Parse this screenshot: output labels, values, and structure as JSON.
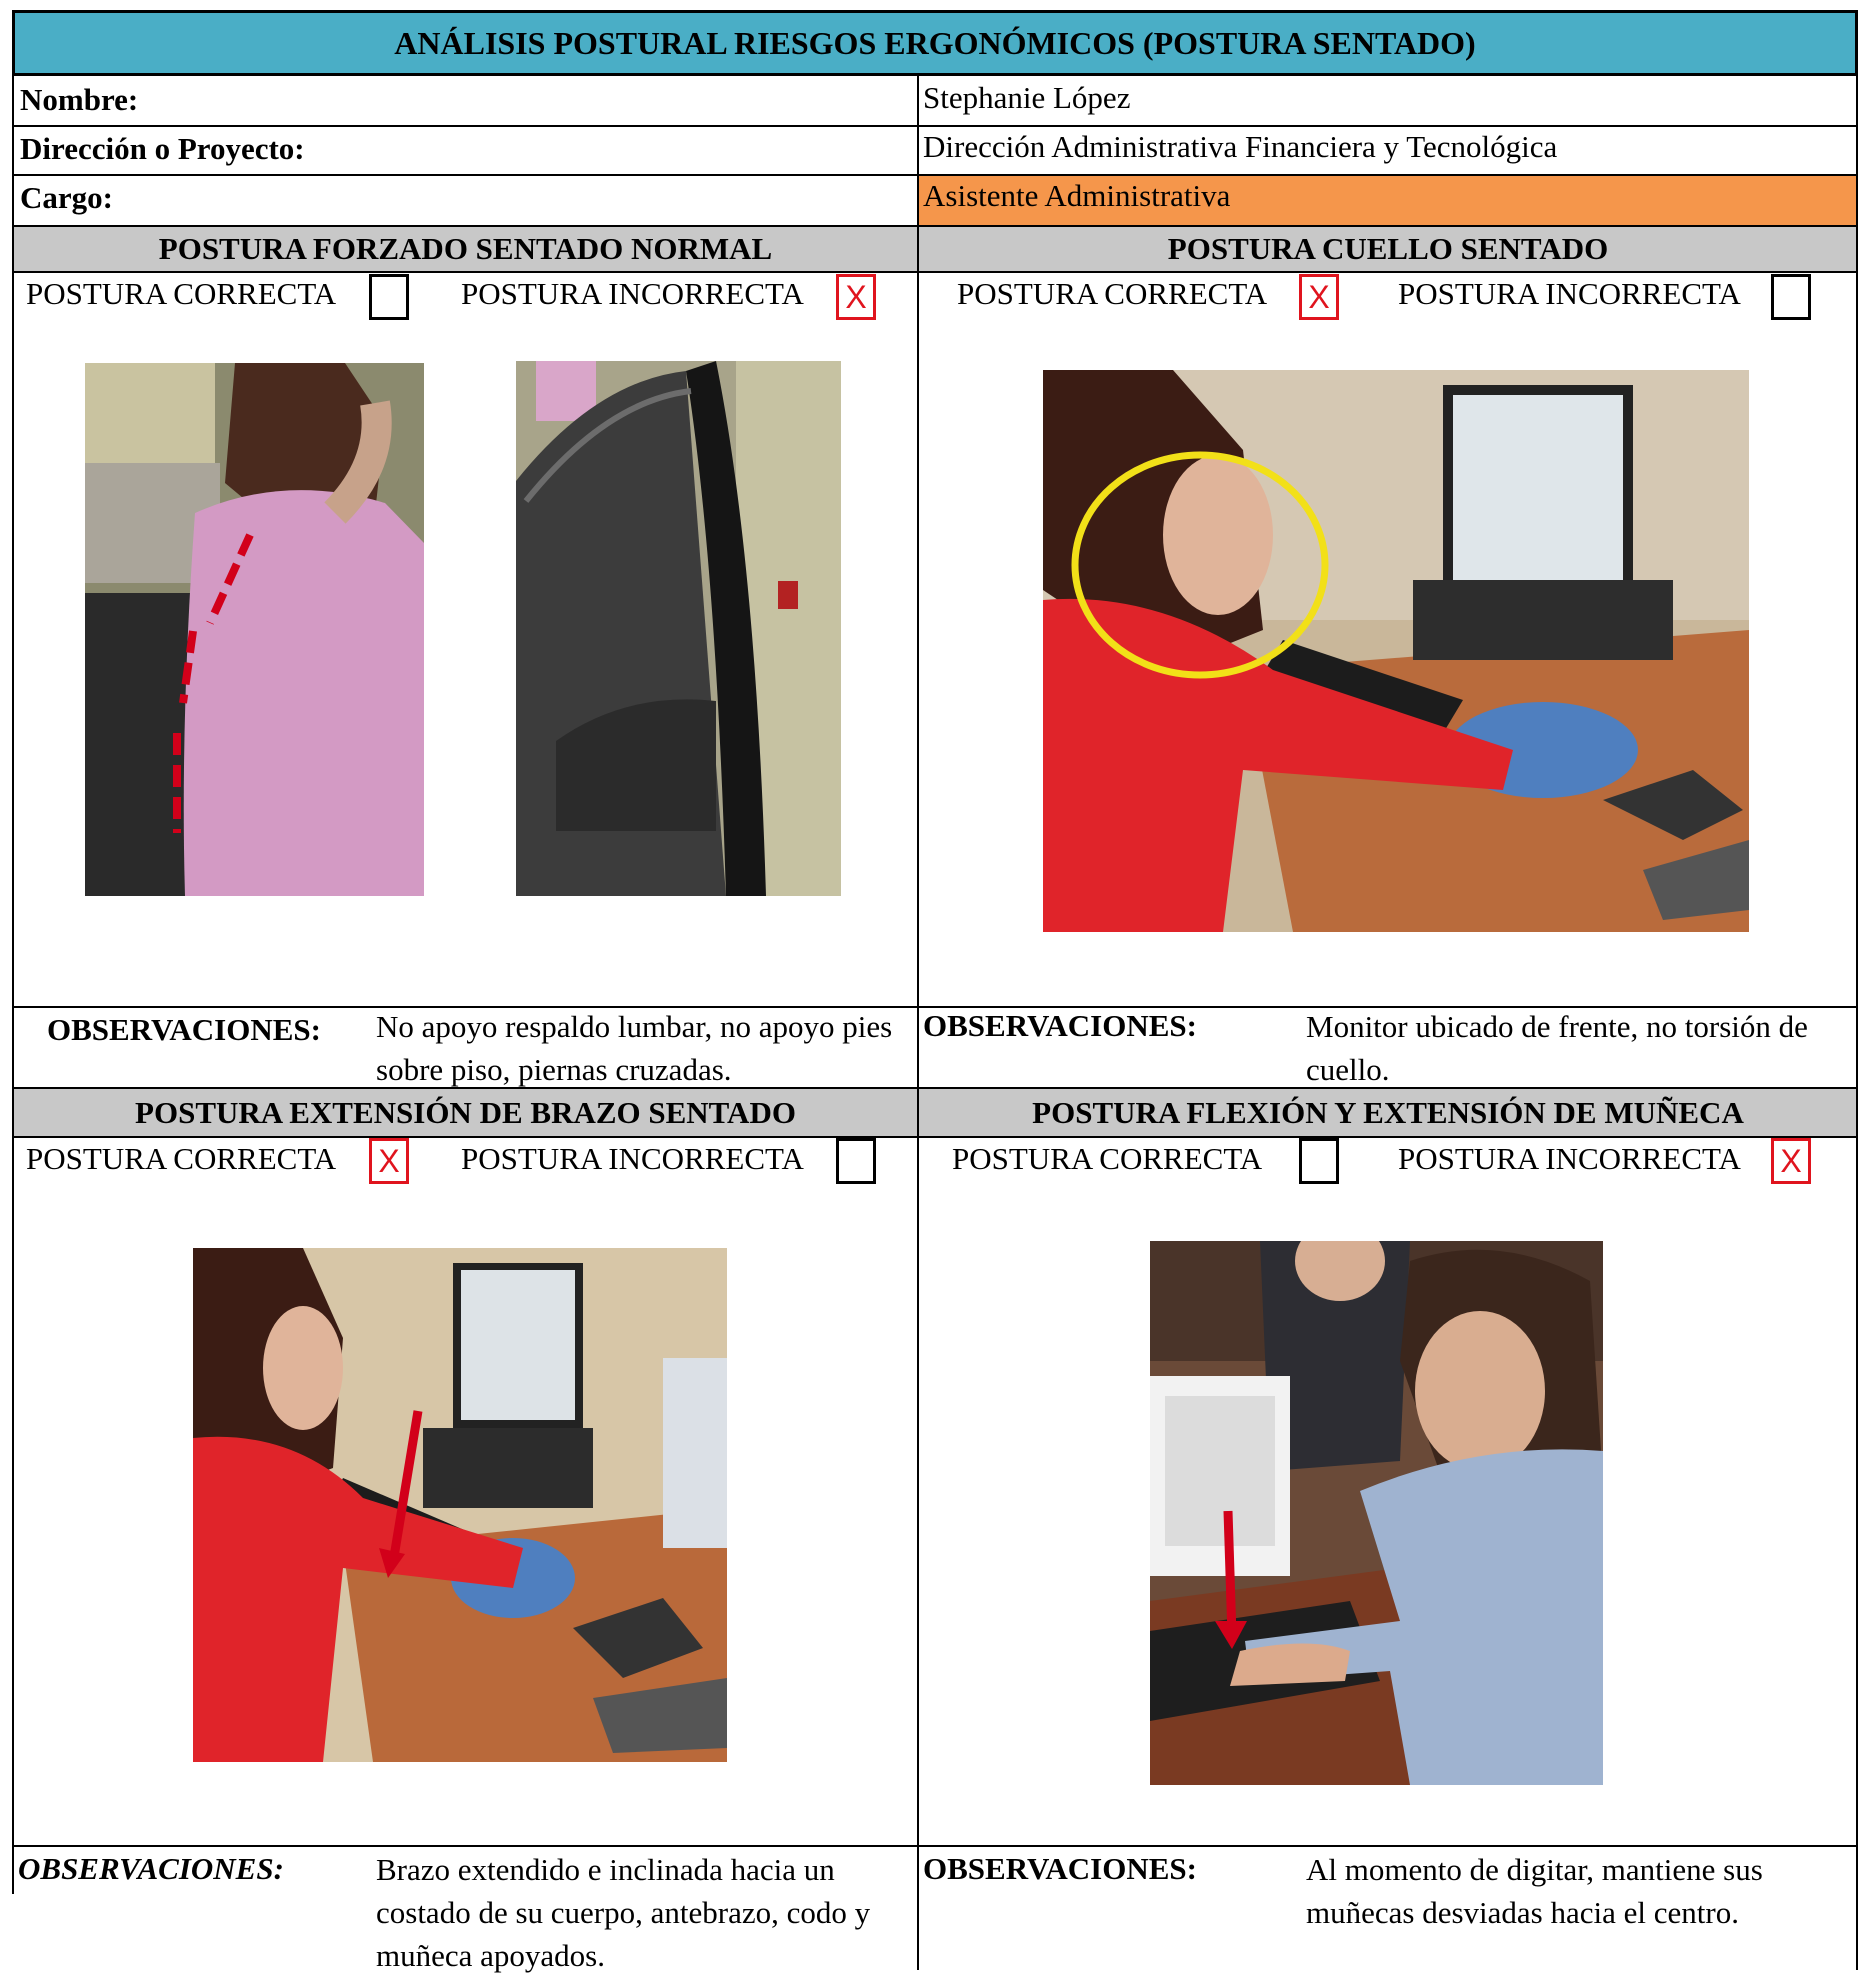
{
  "title": "ANÁLISIS POSTURAL RIESGOS ERGONÓMICOS (POSTURA SENTADO)",
  "info": {
    "nombre_label": "Nombre:",
    "nombre_value": "Stephanie López",
    "direccion_label": "Dirección o Proyecto:",
    "direccion_value": "Dirección Administrativa Financiera y Tecnológica",
    "cargo_label": "Cargo:",
    "cargo_value": "Asistente Administrativa"
  },
  "colors": {
    "title_bg": "#4aaec6",
    "cargo_highlight": "#f5964b",
    "section_bg": "#c8c8c8",
    "mark": "#e0141e"
  },
  "option_labels": {
    "correcta": "POSTURA CORRECTA",
    "incorrecta": "POSTURA INCORRECTA",
    "mark": "X"
  },
  "sections": [
    {
      "title": "POSTURA FORZADO SENTADO NORMAL",
      "correcta_checked": false,
      "incorrecta_checked": true,
      "obs_label": "OBSERVACIONES:",
      "obs_text": "No apoyo respaldo lumbar, no apoyo pies sobre piso, piernas cruzadas."
    },
    {
      "title": "POSTURA CUELLO SENTADO",
      "correcta_checked": true,
      "incorrecta_checked": false,
      "obs_label": "OBSERVACIONES:",
      "obs_text": "Monitor ubicado de frente, no torsión de cuello."
    },
    {
      "title": "POSTURA EXTENSIÓN DE BRAZO SENTADO",
      "correcta_checked": true,
      "incorrecta_checked": false,
      "obs_label": "OBSERVACIONES:",
      "obs_text": "Brazo extendido e inclinada hacia un costado de su cuerpo, antebrazo, codo y muñeca apoyados."
    },
    {
      "title": "POSTURA FLEXIÓN Y EXTENSIÓN DE MUÑECA",
      "correcta_checked": false,
      "incorrecta_checked": true,
      "obs_label": "OBSERVACIONES:",
      "obs_text": "Al momento de digitar, mantiene sus muñecas desviadas hacia el centro."
    }
  ]
}
